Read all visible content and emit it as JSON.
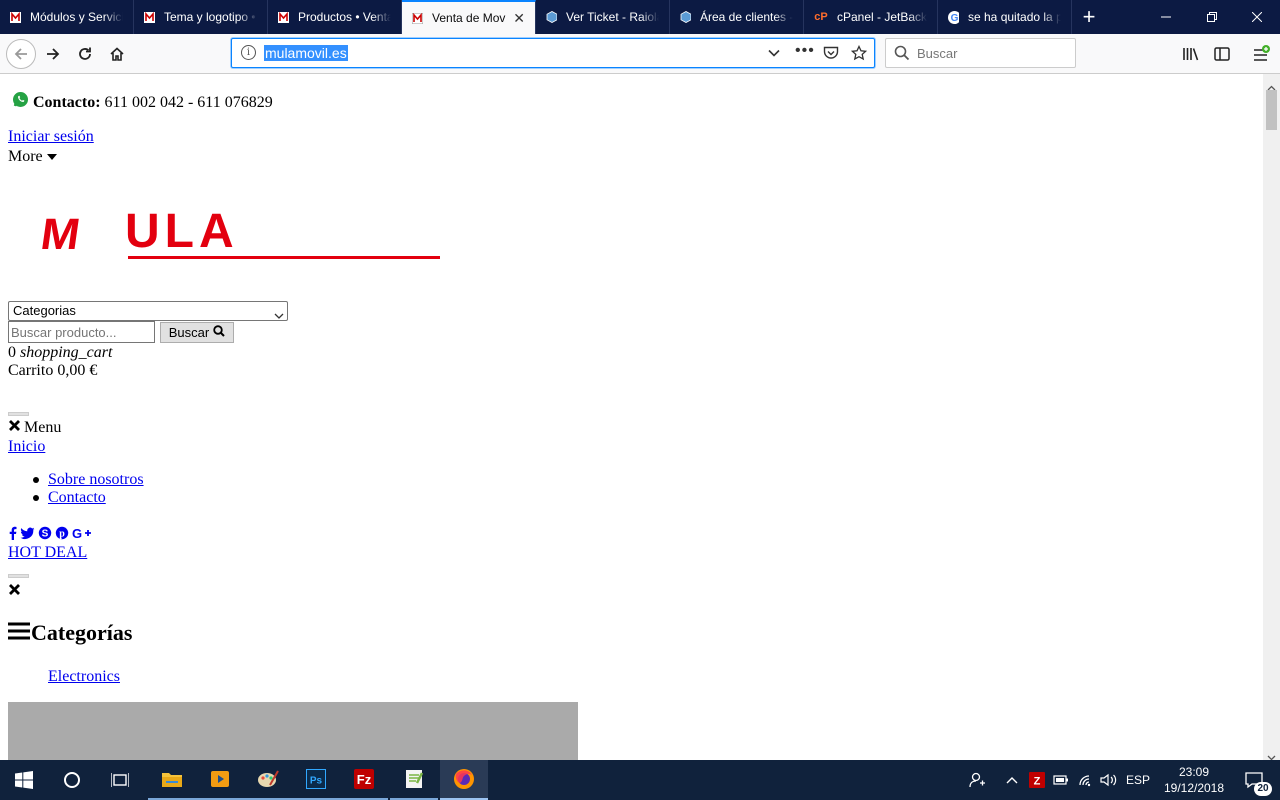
{
  "browser": {
    "tabs": [
      {
        "title": "Módulos y Servicios",
        "icon": "mula-favicon"
      },
      {
        "title": "Tema y logotipo • Venta",
        "icon": "mula-favicon"
      },
      {
        "title": "Productos • Venta de",
        "icon": "mula-favicon"
      },
      {
        "title": "Venta de Mov",
        "icon": "mula-favicon",
        "active": true
      },
      {
        "title": "Ver Ticket - Raiola",
        "icon": "cube-favicon"
      },
      {
        "title": "Área de clientes - Raiola",
        "icon": "cube-favicon"
      },
      {
        "title": "cPanel - JetBackup",
        "icon": "cpanel-favicon"
      },
      {
        "title": "se ha quitado la p",
        "icon": "google-favicon"
      }
    ],
    "url": "mulamovil.es",
    "search_placeholder": "Buscar"
  },
  "page": {
    "contact_label": "Contacto:",
    "contact_phones": "611 002 042 - 611 076829",
    "login_link": "Iniciar sesión",
    "more_label": "More",
    "logo_text": "ULA",
    "logo_letter": "M",
    "category_select": "Categorias",
    "search_placeholder": "Buscar producto...",
    "search_button": "Buscar",
    "cart_count": "0",
    "cart_icon_text": "shopping_cart",
    "cart_label": "Carrito",
    "cart_total": "0,00 €",
    "menu_label": "Menu",
    "home_link": "Inicio",
    "nav_links": [
      "Sobre nosotros",
      "Contacto"
    ],
    "hot_deal": "HOT DEAL",
    "categories_heading": "Categorías",
    "category_item": "Electronics"
  },
  "taskbar": {
    "language": "ESP",
    "time": "23:09",
    "date": "19/12/2018",
    "notification_count": "20"
  },
  "colors": {
    "tabbar_bg": "#0c1a43",
    "accent": "#0a84ff",
    "logo_red": "#e3000f",
    "link": "#0000ee",
    "taskbar_bg": "#10223c"
  }
}
